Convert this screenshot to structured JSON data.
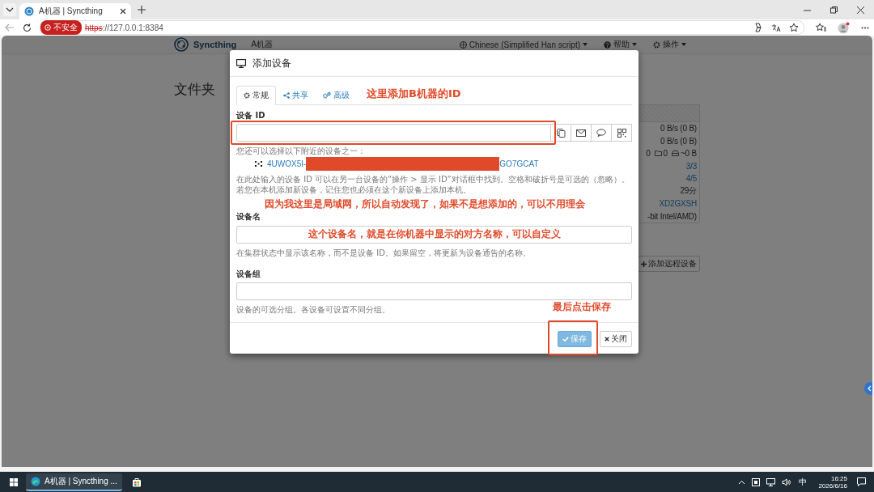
{
  "browser": {
    "tabs": [
      {
        "title": "A机器 | Syncthing",
        "selected": true
      }
    ],
    "security_label": "不安全",
    "url_scheme": "https",
    "url_rest": "://127.0.0.1:8384"
  },
  "navbar": {
    "brand": "Syncthing",
    "device_name": "A机器",
    "menus": [
      {
        "kind": "language",
        "label": "Chinese (Simplified Han script)"
      },
      {
        "kind": "help",
        "label": "帮助"
      },
      {
        "kind": "actions",
        "label": "操作"
      }
    ]
  },
  "page": {
    "heading": "文件夹",
    "status_rows": [
      {
        "kind": "text",
        "value": "0 B/s (0 B)",
        "link": false
      },
      {
        "kind": "text",
        "value": "0 B/s (0 B)",
        "link": false
      },
      {
        "kind": "counts",
        "values": [
          "0",
          "0",
          "~0 B"
        ]
      },
      {
        "kind": "text",
        "value": "3/3",
        "link": true
      },
      {
        "kind": "text",
        "value": "4/5",
        "link": true
      },
      {
        "kind": "text",
        "value": "29分",
        "link": false
      },
      {
        "kind": "text",
        "value": "XD2GXSH",
        "link": true
      },
      {
        "kind": "text",
        "value": "-bit Intel/AMD)",
        "link": false
      }
    ],
    "add_device_button": "添加远程设备"
  },
  "dialog": {
    "title": "添加设备",
    "tabs": [
      {
        "kind": "general",
        "label": "常规",
        "selected": true
      },
      {
        "kind": "sharing",
        "label": "共享",
        "selected": false
      },
      {
        "kind": "advanced",
        "label": "高级",
        "selected": false
      }
    ],
    "tab_note": "这里添加B机器的ID",
    "id_field": {
      "label": "设备 ID",
      "nearby_intro": "您还可以选择以下附近的设备之一：",
      "nearby_start": "4UWOX5I-",
      "nearby_end": "GO7GCAT",
      "help": "在此处输入的设备 ID 可以在另一台设备的“操作 > 显示 ID”对话框中找到。空格和破折号是可选的（忽略）。若您在本机添加新设备，记住您也必须在这个新设备上添加本机。"
    },
    "nearby_note": "因为我这里是局域网，所以自动发现了，如果不是想添加的，可以不用理会",
    "name_field": {
      "label": "设备名",
      "note": "这个设备名，就是在你机器中显示的对方名称，可以自定义",
      "help": "在集群状态中显示该名称，而不是设备 ID。如果留空，将更新为设备通告的名称。"
    },
    "group_field": {
      "label": "设备组",
      "help": "设备的可选分组。各设备可设置不同分组。"
    },
    "save_note": "最后点击保存",
    "buttons": [
      {
        "kind": "save",
        "label": "保存"
      },
      {
        "kind": "close",
        "label": "关闭"
      }
    ]
  },
  "taskbar": {
    "apps": [
      {
        "kind": "browser",
        "label": "A机器 | Syncthing ...",
        "selected": true
      },
      {
        "kind": "store",
        "selected": false
      }
    ],
    "ime": "中",
    "time": "16:25",
    "date": "2026/6/16"
  }
}
